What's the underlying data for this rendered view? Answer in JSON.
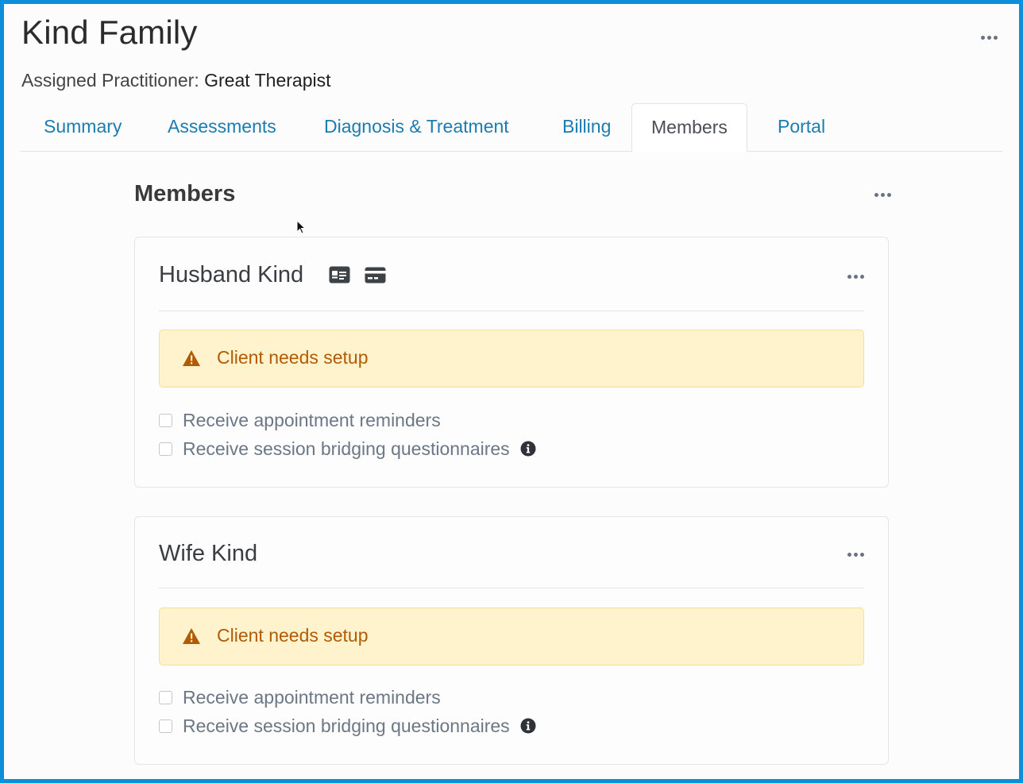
{
  "page": {
    "title": "Kind Family",
    "practitioner_label": "Assigned Practitioner:",
    "practitioner_name": "Great Therapist",
    "menu_icon": "more-horizontal-icon"
  },
  "tabs": [
    {
      "label": "Summary",
      "active": false
    },
    {
      "label": "Assessments",
      "active": false
    },
    {
      "label": "Diagnosis & Treatment",
      "active": false
    },
    {
      "label": "Billing",
      "active": false
    },
    {
      "label": "Members",
      "active": true
    },
    {
      "label": "Portal",
      "active": false
    }
  ],
  "members": {
    "title": "Members",
    "cards": [
      {
        "name": "Husband Kind",
        "icons": [
          "id-card-icon",
          "credit-card-icon"
        ],
        "alert": "Client needs setup",
        "options": [
          {
            "label": "Receive appointment reminders",
            "checked": false
          },
          {
            "label": "Receive session bridging questionnaires",
            "checked": false
          }
        ]
      },
      {
        "name": "Wife Kind",
        "icons": [],
        "alert": "Client needs setup",
        "options": [
          {
            "label": "Receive appointment reminders",
            "checked": false
          },
          {
            "label": "Receive session bridging questionnaires",
            "checked": false
          }
        ]
      }
    ]
  },
  "colors": {
    "frame_border": "#0a8fd8",
    "tab_link": "#1b7cb0",
    "alert_bg": "#fef3cd",
    "alert_text": "#b35a05"
  }
}
